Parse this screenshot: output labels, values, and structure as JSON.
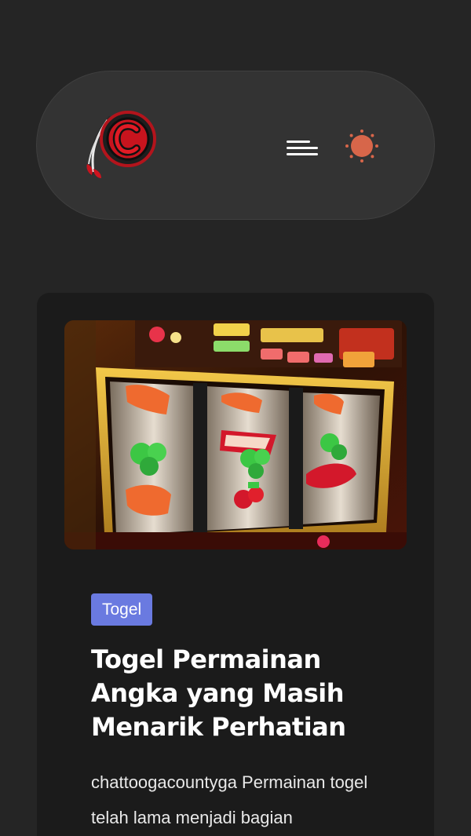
{
  "header": {
    "logo_icon": "feather-c-logo-icon",
    "menu_icon": "hamburger-menu-icon",
    "theme_icon": "sun-icon",
    "accent_color": "#d7664a"
  },
  "post": {
    "image_icon": "slot-machine-image",
    "category_label": "Togel",
    "category_color": "#6a7ae0",
    "title": "Togel Permainan Angka yang Masih Menarik Perhatian",
    "excerpt": "chattoogacountyga Permainan togel telah lama menjadi bagian"
  },
  "colors": {
    "page_background": "#252525",
    "header_background": "#333333",
    "card_background": "#1b1b1b"
  }
}
